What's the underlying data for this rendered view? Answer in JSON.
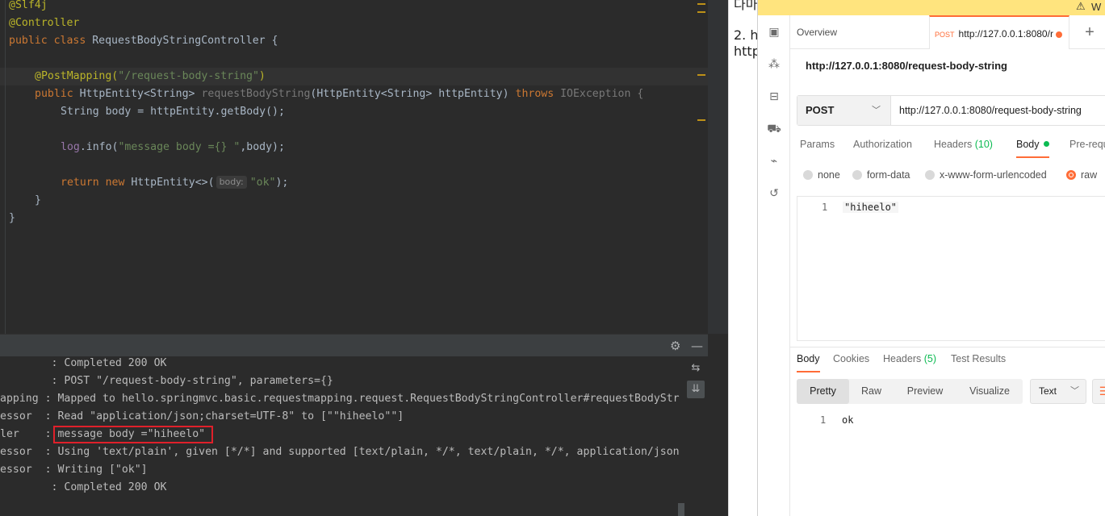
{
  "editor": {
    "lines": [
      {
        "ann": "@Slf4j"
      },
      {
        "ann": "@Controller"
      },
      {
        "kw": "public class ",
        "cls": "RequestBodyStringController {"
      },
      {},
      {
        "ann": "@PostMapping(",
        "str": "\"/request-body-string\"",
        "close": ")"
      },
      {
        "kw": "public ",
        "type": "HttpEntity<String> ",
        "method": "requestBodyString",
        "params": "(HttpEntity<String> httpEntity) ",
        "throws": "throws ",
        "exc": "IOException {"
      },
      {
        "text": "String body = httpEntity.getBody();"
      },
      {},
      {
        "field": "log",
        "text": ".info(",
        "str": "\"message body ={} \"",
        "rest": ",body);"
      },
      {},
      {
        "kw": "return new ",
        "text": "HttpEntity<>(",
        "hint": "body:",
        "str": "\"ok\"",
        "rest": ");"
      },
      {
        "text": "}"
      },
      {
        "text": "}"
      }
    ]
  },
  "console": {
    "lines": [
      {
        "prefix": "        ",
        "msg": ": Completed 200 OK"
      },
      {
        "prefix": "        ",
        "msg": ": POST \"/request-body-string\", parameters={}"
      },
      {
        "prefix": "apping ",
        "msg": ": Mapped to hello.springmvc.basic.requestmapping.request.RequestBodyStringController#requestBodyStr"
      },
      {
        "prefix": "essor  ",
        "msg": ": Read \"application/json;charset=UTF-8\" to [\"\"hiheelo\"\"]"
      },
      {
        "prefix": "ler    ",
        "msg": ": message body =\"hiheelo\""
      },
      {
        "prefix": "essor  ",
        "msg": ": Using 'text/plain', given [*/*] and supported [text/plain, */*, text/plain, */*, application/json"
      },
      {
        "prefix": "essor  ",
        "msg": ": Writing [\"ok\"]"
      },
      {
        "prefix": "        ",
        "msg": ": Completed 200 OK"
      }
    ]
  },
  "doc": {
    "line1": "다마",
    "line2": "2. h",
    "line3": "http"
  },
  "postman": {
    "banner_text": "W",
    "tabs": {
      "overview": "Overview",
      "request_method": "POST",
      "request_url": "http://127.0.0.1:8080/r",
      "add": "+"
    },
    "title": "http://127.0.0.1:8080/request-body-string",
    "method": "POST",
    "url": "http://127.0.0.1:8080/request-body-string",
    "request_tabs": {
      "params": "Params",
      "authorization": "Authorization",
      "headers": "Headers ",
      "headers_count": "(10)",
      "body": "Body",
      "prerequest": "Pre-requ"
    },
    "body_types": {
      "none": "none",
      "form_data": "form-data",
      "urlencoded": "x-www-form-urlencoded",
      "raw": "raw"
    },
    "body_editor": {
      "line_no": "1",
      "content": "\"hiheelo\""
    },
    "response_tabs": {
      "body": "Body",
      "cookies": "Cookies",
      "headers": "Headers ",
      "headers_count": "(5)",
      "test_results": "Test Results"
    },
    "view_modes": {
      "pretty": "Pretty",
      "raw": "Raw",
      "preview": "Preview",
      "visualize": "Visualize"
    },
    "format": "Text",
    "response": {
      "line_no": "1",
      "content": "ok"
    }
  },
  "colors": {
    "accent": "#ff6c37",
    "success": "#0cbb52",
    "highlight_box": "#e0202a"
  }
}
